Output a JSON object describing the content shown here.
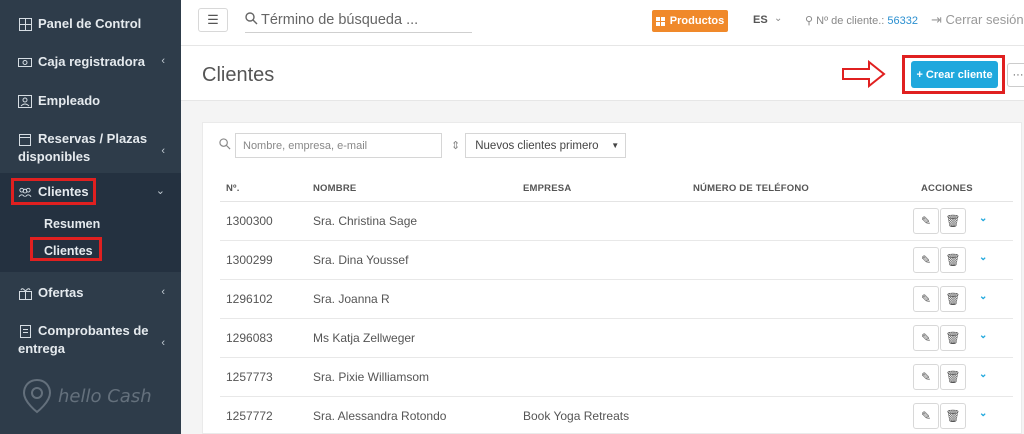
{
  "sidebar": {
    "items": [
      {
        "label": "Panel de Control",
        "icon": "dashboard-icon"
      },
      {
        "label": "Caja registradora",
        "icon": "cash-register-icon"
      },
      {
        "label": "Empleado",
        "icon": "employee-icon"
      },
      {
        "label": "Reservas / Plazas",
        "label2": "disponibles",
        "icon": "calendar-icon"
      },
      {
        "label": "Clientes",
        "icon": "clients-icon"
      },
      {
        "label": "Ofertas",
        "icon": "offers-icon"
      },
      {
        "label": "Comprobantes de",
        "label2": "entrega",
        "icon": "delivery-note-icon"
      }
    ],
    "sub_items": [
      "Resumen",
      "Clientes"
    ],
    "logo_text": "hello Cash"
  },
  "topbar": {
    "search_placeholder": "Término de búsqueda ...",
    "products_label": "Productos",
    "lang": "ES",
    "client_no_label": "Nº de cliente.:",
    "client_no": "56332",
    "logout_label": "Cerrar sesión"
  },
  "page": {
    "title": "Clientes",
    "create_label": "+ Crear cliente",
    "more_label": "···"
  },
  "filters": {
    "search_placeholder": "Nombre, empresa, e-mail",
    "sort_value": "Nuevos clientes primero"
  },
  "table": {
    "headers": [
      "Nº.",
      "NOMBRE",
      "EMPRESA",
      "NÚMERO DE TELÉFONO",
      "ACCIONES"
    ],
    "rows": [
      {
        "no": "1300300",
        "name": "Sra. Christina Sage",
        "company": "",
        "phone": ""
      },
      {
        "no": "1300299",
        "name": "Sra. Dina Youssef",
        "company": "",
        "phone": ""
      },
      {
        "no": "1296102",
        "name": "Sra. Joanna R",
        "company": "",
        "phone": ""
      },
      {
        "no": "1296083",
        "name": "Ms Katja Zellweger",
        "company": "",
        "phone": ""
      },
      {
        "no": "1257773",
        "name": "Sra. Pixie Williamsom",
        "company": "",
        "phone": ""
      },
      {
        "no": "1257772",
        "name": "Sra. Alessandra Rotondo",
        "company": "Book Yoga Retreats",
        "phone": ""
      }
    ]
  },
  "colors": {
    "sidebar_bg": "#2e3c4a",
    "accent": "#20a8dd",
    "products_orange": "#f0892a",
    "highlight_red": "#e02020"
  }
}
